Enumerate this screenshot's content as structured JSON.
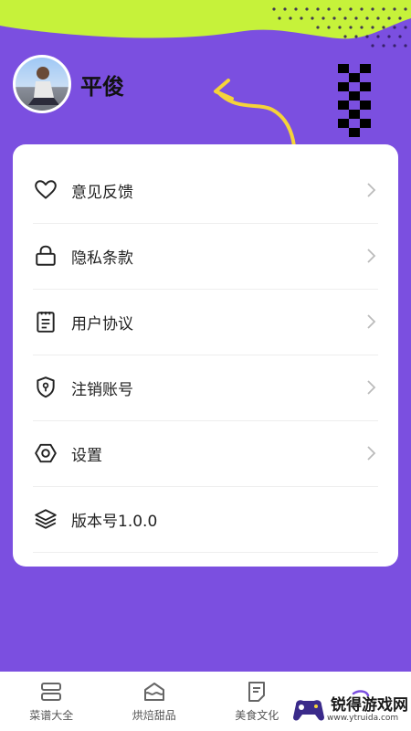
{
  "profile": {
    "name": "平俊"
  },
  "menu": [
    {
      "label": "意见反馈",
      "icon": "heart-icon",
      "chevron": true
    },
    {
      "label": "隐私条款",
      "icon": "lock-icon",
      "chevron": true
    },
    {
      "label": "用户协议",
      "icon": "document-icon",
      "chevron": true
    },
    {
      "label": "注销账号",
      "icon": "shield-key-icon",
      "chevron": true
    },
    {
      "label": "设置",
      "icon": "hexagon-settings-icon",
      "chevron": true
    },
    {
      "label": "版本号1.0.0",
      "icon": "layers-icon",
      "chevron": false
    }
  ],
  "tabs": [
    {
      "label": "菜谱大全",
      "icon": "menu-list-icon"
    },
    {
      "label": "烘焙甜品",
      "icon": "cake-icon"
    },
    {
      "label": "美食文化",
      "icon": "note-icon"
    },
    {
      "label": "",
      "icon": "profile-icon"
    }
  ],
  "watermark": {
    "title": "锐得游戏网",
    "url": "www.ytruida.com"
  },
  "colors": {
    "background": "#7b4fe0",
    "accent_green": "#c6f23a",
    "card": "#ffffff"
  }
}
